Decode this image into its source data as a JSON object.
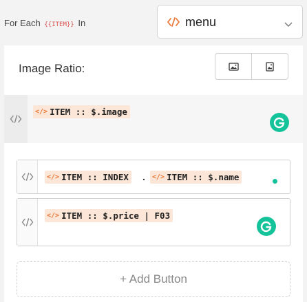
{
  "foreach": {
    "prefix": "For Each",
    "tag": "{{ITEM}}",
    "suffix": "In",
    "select_value": "menu"
  },
  "image_ratio": {
    "label": "Image Ratio:",
    "options": [
      "landscape-image-icon",
      "portrait-image-icon"
    ]
  },
  "blocks": {
    "image_chip": "ITEM :: $.image",
    "name_field": {
      "index_chip": "ITEM :: INDEX",
      "separator": ".",
      "name_chip": "ITEM :: $.name"
    },
    "price_chip": "ITEM :: $.price | F03"
  },
  "add_button_label": "+ Add Button",
  "colors": {
    "accent": "#e8793a",
    "chip_bg": "#fbe6d7",
    "grammarly": "#15c39a"
  }
}
